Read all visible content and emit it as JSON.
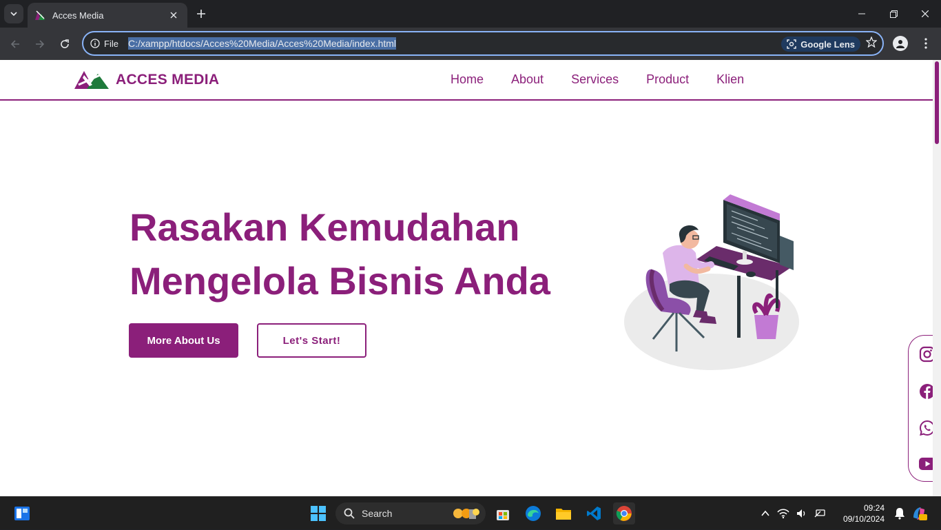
{
  "browser": {
    "tab_title": "Acces Media",
    "site_info_label": "File",
    "url": "C:/xampp/htdocs/Acces%20Media/Acces%20Media/index.html",
    "lens_label": "Google Lens"
  },
  "site": {
    "brand": "ACCES MEDIA",
    "nav": [
      "Home",
      "About",
      "Services",
      "Product",
      "Klien"
    ],
    "hero_line1": "Rasakan Kemudahan",
    "hero_line2": "Mengelola Bisnis Anda",
    "primary_button": "More About Us",
    "secondary_button": "Let's Start!",
    "social_icons": [
      "instagram-icon",
      "facebook-icon",
      "whatsapp-icon",
      "youtube-icon"
    ],
    "colors": {
      "brand": "#8b1f7a",
      "accent_light": "#c27ad4",
      "dark": "#263238"
    }
  },
  "taskbar": {
    "search_label": "Search",
    "time": "09:24",
    "date": "09/10/2024"
  }
}
